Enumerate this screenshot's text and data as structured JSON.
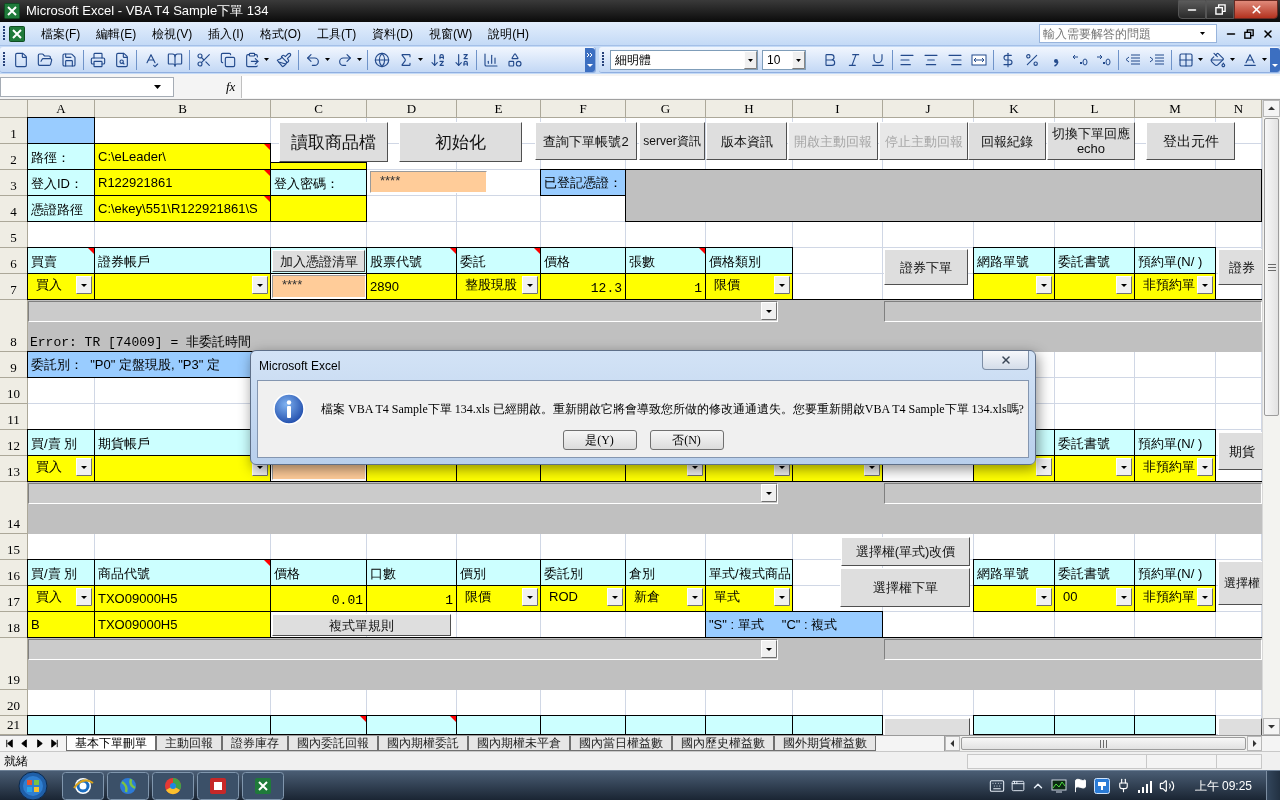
{
  "window": {
    "title": "Microsoft Excel - VBA T4 Sample下單 134"
  },
  "menu_bar": {
    "items": [
      "檔案(F)",
      "編輯(E)",
      "檢視(V)",
      "插入(I)",
      "格式(O)",
      "工具(T)",
      "資料(D)",
      "視窗(W)",
      "說明(H)"
    ],
    "help_box": {
      "placeholder": "輸入需要解答的問題"
    }
  },
  "formatting_toolbar": {
    "font": "細明體",
    "font_size": "10"
  },
  "formula_bar": {
    "function_label": "fx"
  },
  "columns": [
    "A",
    "B",
    "C",
    "D",
    "E",
    "F",
    "G",
    "H",
    "I",
    "J",
    "K",
    "L",
    "M",
    "N"
  ],
  "rows": [
    {
      "number": "1",
      "cells": [
        {
          "kind": "note",
          "comment": false
        }
      ]
    },
    {
      "number": "2",
      "cells": [
        {
          "kind": "label",
          "text": "路徑：",
          "comment": false
        },
        {
          "kind": "text",
          "text": "C:\\eLeader\\",
          "comment": true
        },
        {
          "kind": "text",
          "comment": false
        }
      ]
    },
    {
      "number": "3",
      "cells": [
        {
          "kind": "label",
          "text": "登入ID：",
          "comment": false
        },
        {
          "kind": "text",
          "text": "R122921861",
          "comment": true
        },
        {
          "kind": "label",
          "text": "登入密碼：",
          "comment": false
        },
        {
          "kind": "password",
          "text": "****",
          "comment": false
        },
        {
          "kind": "note",
          "text": "已登記憑證：",
          "comment": false
        },
        {
          "kind": "shade",
          "comment": false
        }
      ]
    },
    {
      "number": "4",
      "cells": [
        {
          "kind": "label",
          "text": "憑證路徑",
          "comment": false
        },
        {
          "kind": "text",
          "text": "C:\\ekey\\551\\R122921861\\S",
          "comment": true
        },
        {
          "kind": "text",
          "comment": false
        }
      ]
    },
    {
      "number": "5"
    },
    {
      "number": "6",
      "cells": [
        {
          "kind": "label",
          "text": "買賣",
          "comment": true
        },
        {
          "kind": "label",
          "text": "證券帳戶",
          "comment": false
        },
        {
          "kind": "label",
          "comment": false
        },
        {
          "kind": "label",
          "text": "股票代號",
          "comment": true
        },
        {
          "kind": "label",
          "text": "委託",
          "comment": true
        },
        {
          "kind": "label",
          "text": "價格",
          "comment": false
        },
        {
          "kind": "label",
          "text": "張數",
          "comment": true
        },
        {
          "kind": "label",
          "text": "價格類別",
          "comment": false
        },
        {
          "kind": "label",
          "text": "網路單號",
          "comment": false
        },
        {
          "kind": "label",
          "text": "委託書號",
          "comment": false
        },
        {
          "kind": "label",
          "text": "預約單(N/ )",
          "comment": false
        }
      ]
    },
    {
      "number": "7",
      "cells": [
        {
          "kind": "dropdown",
          "text": "買入",
          "comment": false
        },
        {
          "kind": "dropdown",
          "comment": false
        },
        {
          "kind": "password",
          "text": "****",
          "comment": false
        },
        {
          "kind": "text",
          "text": "2890",
          "comment": false
        },
        {
          "kind": "dropdown",
          "text": "整股現股",
          "comment": false
        },
        {
          "kind": "number",
          "text": "12.3",
          "comment": false
        },
        {
          "kind": "number",
          "text": "1",
          "comment": false
        },
        {
          "kind": "dropdown",
          "text": "限價",
          "comment": false
        },
        {
          "kind": "dropdown",
          "comment": false
        },
        {
          "kind": "dropdown",
          "comment": false
        },
        {
          "kind": "dropdown",
          "text": "非預約單",
          "comment": false
        }
      ]
    },
    {
      "number": "8",
      "cells": [
        {
          "kind": "panel",
          "text": "Error: TR [74009] = 非委託時間",
          "comment": false
        }
      ]
    },
    {
      "number": "9",
      "cells": [
        {
          "kind": "note",
          "text": "委託別：  \"P0\" 定盤現股, \"P3\" 定",
          "comment": false
        }
      ]
    },
    {
      "number": "10"
    },
    {
      "number": "11"
    },
    {
      "number": "12",
      "cells": [
        {
          "kind": "label",
          "text": "買/賣 別",
          "comment": false
        },
        {
          "kind": "label",
          "text": "期貨帳戶",
          "comment": false
        },
        {
          "kind": "label",
          "comment": false
        },
        {
          "kind": "label",
          "text": "委託書號",
          "comment": false
        },
        {
          "kind": "label",
          "text": "預約單(N/ )",
          "comment": false
        }
      ]
    },
    {
      "number": "13",
      "cells": [
        {
          "kind": "dropdown",
          "text": "買入",
          "comment": false
        },
        {
          "kind": "dropdown",
          "comment": false
        },
        {
          "kind": "password",
          "comment": false
        },
        {
          "kind": "text",
          "comment": false
        },
        {
          "kind": "number",
          "comment": false
        },
        {
          "kind": "number",
          "comment": false
        },
        {
          "kind": "dropdown",
          "comment": false
        },
        {
          "kind": "dropdown",
          "comment": false
        },
        {
          "kind": "dropdown",
          "comment": false
        },
        {
          "kind": "dropdown",
          "comment": false
        },
        {
          "kind": "dropdown",
          "comment": false
        },
        {
          "kind": "dropdown",
          "text": "非預約單",
          "comment": false
        }
      ]
    },
    {
      "number": "14",
      "cells": [
        {
          "kind": "panel",
          "comment": false
        }
      ]
    },
    {
      "number": "15"
    },
    {
      "number": "16",
      "cells": [
        {
          "kind": "label",
          "text": "買/賣 別",
          "comment": false
        },
        {
          "kind": "label",
          "text": "商品代號",
          "comment": true
        },
        {
          "kind": "label",
          "text": "價格",
          "comment": false
        },
        {
          "kind": "label",
          "text": "口數",
          "comment": false
        },
        {
          "kind": "label",
          "text": "價別",
          "comment": false
        },
        {
          "kind": "label",
          "text": "委託別",
          "comment": false
        },
        {
          "kind": "label",
          "text": "倉別",
          "comment": false
        },
        {
          "kind": "label",
          "text": "單式/複式商品",
          "comment": false
        },
        {
          "kind": "label",
          "text": "網路單號",
          "comment": false
        },
        {
          "kind": "label",
          "text": "委託書號",
          "comment": false
        },
        {
          "kind": "label",
          "text": "預約單(N/ )",
          "comment": false
        }
      ]
    },
    {
      "number": "17",
      "cells": [
        {
          "kind": "dropdown",
          "text": "買入",
          "comment": false
        },
        {
          "kind": "text",
          "text": "TXO09000H5",
          "comment": false
        },
        {
          "kind": "number",
          "text": "0.01",
          "comment": false
        },
        {
          "kind": "number",
          "text": "1",
          "comment": false
        },
        {
          "kind": "dropdown",
          "text": "限價",
          "comment": false
        },
        {
          "kind": "dropdown",
          "text": "ROD",
          "comment": false
        },
        {
          "kind": "dropdown",
          "text": "新倉",
          "comment": false
        },
        {
          "kind": "dropdown",
          "text": "單式",
          "comment": false
        },
        {
          "kind": "dropdown",
          "comment": false
        },
        {
          "kind": "dropdown",
          "text": "00",
          "comment": false
        },
        {
          "kind": "dropdown",
          "text": "非預約單",
          "comment": false
        }
      ]
    },
    {
      "number": "18",
      "cells": [
        {
          "kind": "text",
          "text": "B",
          "comment": false
        },
        {
          "kind": "text",
          "text": "TXO09000H5",
          "comment": false
        },
        {
          "kind": "note",
          "text": "\"S\" : 單式     \"C\" : 複式",
          "comment": false
        }
      ]
    },
    {
      "number": "19",
      "cells": [
        {
          "kind": "panel",
          "comment": false
        }
      ]
    },
    {
      "number": "20"
    },
    {
      "number": "21",
      "cells": [
        {
          "kind": "label",
          "comment": false
        },
        {
          "kind": "label",
          "comment": false
        },
        {
          "kind": "label",
          "comment": true
        },
        {
          "kind": "label",
          "comment": true
        },
        {
          "kind": "label",
          "comment": false
        },
        {
          "kind": "label",
          "comment": false
        },
        {
          "kind": "label",
          "comment": false
        },
        {
          "kind": "label",
          "comment": false
        },
        {
          "kind": "label",
          "comment": false
        },
        {
          "kind": "button",
          "comment": false
        },
        {
          "kind": "label",
          "comment": false
        },
        {
          "kind": "label",
          "comment": false
        },
        {
          "kind": "label",
          "comment": false
        },
        {
          "kind": "button",
          "comment": false
        }
      ]
    }
  ],
  "sheet_buttons": [
    {
      "label": "讀取商品檔",
      "disabled": false
    },
    {
      "label": "初始化",
      "disabled": false
    },
    {
      "label": "查詢下單帳號2",
      "disabled": false
    },
    {
      "label": "server資訊",
      "disabled": false
    },
    {
      "label": "版本資訊",
      "disabled": false
    },
    {
      "label": "開啟主動回報",
      "disabled": true
    },
    {
      "label": "停止主動回報",
      "disabled": true
    },
    {
      "label": "回報紀錄",
      "disabled": false
    },
    {
      "label": "切換下單回應\necho",
      "disabled": false
    },
    {
      "label": "登出元件",
      "disabled": false
    },
    {
      "label": "加入憑證清單",
      "disabled": false
    },
    {
      "label": "證券下單",
      "disabled": false
    },
    {
      "label": "證券",
      "disabled": false
    },
    {
      "label": "期貨",
      "disabled": false
    },
    {
      "label": "選擇權(單式)改價",
      "disabled": false
    },
    {
      "label": "選擇權下單",
      "disabled": false
    },
    {
      "label": "選擇權",
      "disabled": false
    },
    {
      "label": "複式單規則",
      "disabled": false
    }
  ],
  "dialog": {
    "title": "Microsoft Excel",
    "message": "檔案 VBA T4 Sample下單 134.xls 已經開啟。重新開啟它將會導致您所做的修改通通遺失。您要重新開啟VBA T4 Sample下單 134.xls嗎?",
    "buttons": [
      "是(Y)",
      "否(N)"
    ]
  },
  "sheet_tabs": [
    {
      "label": "基本下單刪單",
      "selected": true
    },
    {
      "label": "主動回報",
      "selected": false
    },
    {
      "label": "證券庫存",
      "selected": false
    },
    {
      "label": "國內委託回報",
      "selected": false
    },
    {
      "label": "國內期權委託",
      "selected": false
    },
    {
      "label": "國內期權未平倉",
      "selected": false
    },
    {
      "label": "國內當日權益數",
      "selected": false
    },
    {
      "label": "國內歷史權益數",
      "selected": false
    },
    {
      "label": "國外期貨權益數",
      "selected": false
    }
  ],
  "status_bar": {
    "text": "就緒"
  },
  "taskbar": {
    "clock": "上午 09:25"
  }
}
